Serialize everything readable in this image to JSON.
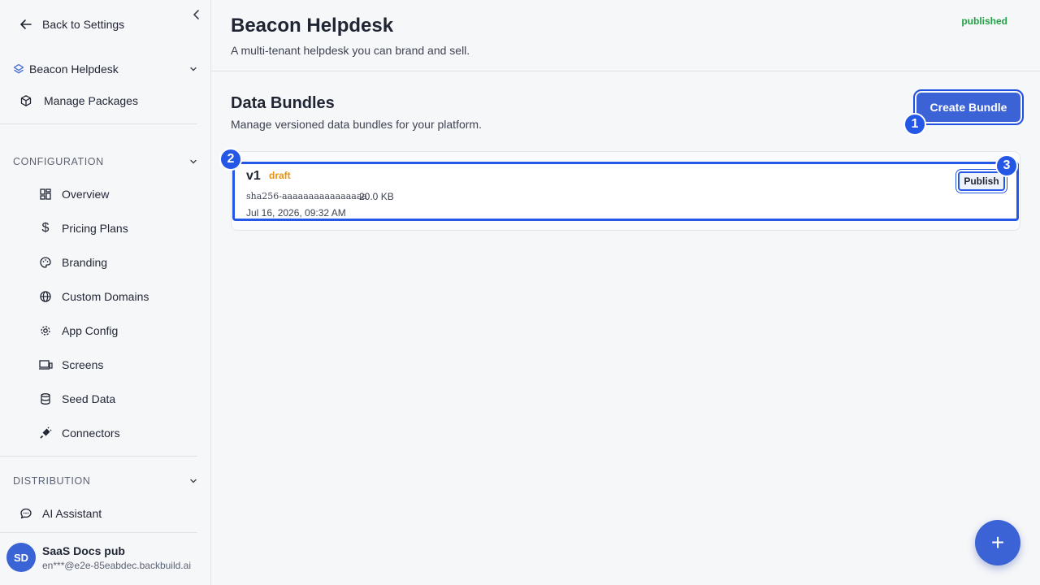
{
  "sidebar": {
    "back_label": "Back to Settings",
    "project_label": "Beacon Helpdesk",
    "packages_label": "Manage Packages",
    "configuration": {
      "heading": "CONFIGURATION",
      "items": [
        {
          "label": "Overview",
          "icon": "dashboard-icon"
        },
        {
          "label": "Pricing Plans",
          "icon": "dollar-icon"
        },
        {
          "label": "Branding",
          "icon": "palette-icon"
        },
        {
          "label": "Custom Domains",
          "icon": "globe-icon"
        },
        {
          "label": "App Config",
          "icon": "gear-icon"
        },
        {
          "label": "Screens",
          "icon": "monitor-icon"
        },
        {
          "label": "Seed Data",
          "icon": "database-icon"
        },
        {
          "label": "Connectors",
          "icon": "plug-icon"
        }
      ]
    },
    "distribution": {
      "heading": "DISTRIBUTION",
      "assistant_label": "AI Assistant"
    },
    "user": {
      "initials": "SD",
      "name": "SaaS Docs pub",
      "email": "en***@e2e-85eabdec.backbuild.ai"
    }
  },
  "header": {
    "title": "Beacon Helpdesk",
    "subtitle": "A multi-tenant helpdesk you can brand and sell.",
    "status": "published"
  },
  "bundles": {
    "title": "Data Bundles",
    "description": "Manage versioned data bundles for your platform.",
    "create_label": "Create Bundle",
    "items": [
      {
        "version": "v1",
        "status": "draft",
        "hash": "sha256-aaaaaaaaaaaaaaaa",
        "size": "20.0 KB",
        "date": "Jul 16, 2026, 09:32 AM",
        "action_label": "Publish"
      }
    ]
  },
  "markers": [
    "1",
    "2",
    "3"
  ],
  "fab_label": "+",
  "colors": {
    "accent": "#3b63d6",
    "published": "#21a045",
    "draft": "#e89211",
    "highlight": "#2457e6"
  }
}
